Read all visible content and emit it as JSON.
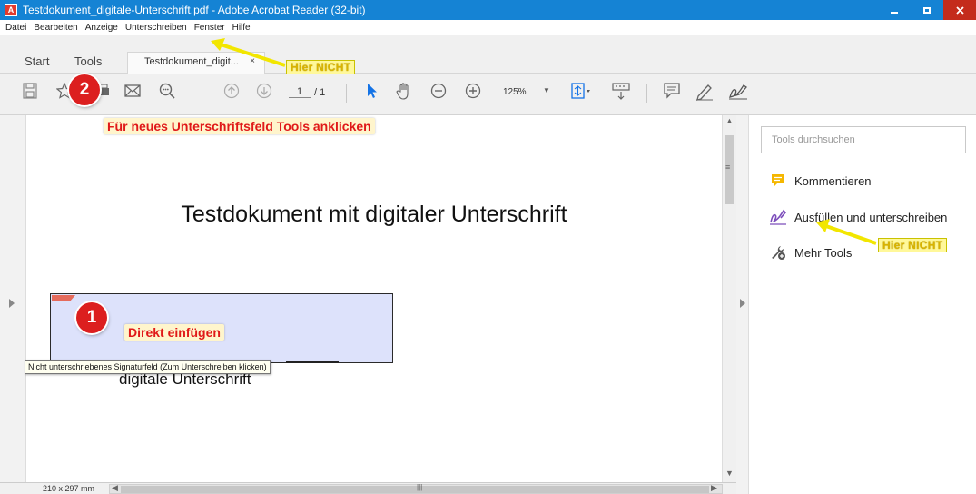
{
  "window": {
    "title": "Testdokument_digitale-Unterschrift.pdf - Adobe Acrobat Reader (32-bit)",
    "app_icon_glyph": "A"
  },
  "menu": [
    "Datei",
    "Bearbeiten",
    "Anzeige",
    "Unterschreiben",
    "Fenster",
    "Hilfe"
  ],
  "tabs": {
    "start": "Start",
    "tools": "Tools",
    "document": "Testdokument_digit...",
    "close_glyph": "×"
  },
  "toolbar": {
    "page_current": "1",
    "page_total": "/ 1",
    "zoom": "125%"
  },
  "document": {
    "heading": "Testdokument mit digitaler Unterschrift",
    "signature_caption": "digitale Unterschrift",
    "tooltip": "Nicht unterschriebenes Signaturfeld (Zum Unterschreiben klicken)",
    "page_size": "210 x 297 mm"
  },
  "tools_pane": {
    "search_placeholder": "Tools durchsuchen",
    "items": [
      {
        "label": "Kommentieren",
        "icon": "comment-icon",
        "color": "#f5b700"
      },
      {
        "label": "Ausfüllen und unterschreiben",
        "icon": "sign-pen-icon",
        "color": "#7c4dbb"
      },
      {
        "label": "Mehr Tools",
        "icon": "more-tools-icon",
        "color": "#555555"
      }
    ]
  },
  "annotations": {
    "badge_1": "1",
    "badge_2": "2",
    "direkt": "Direkt einfügen",
    "tools_hint": "Für neues Unterschriftsfeld Tools anklicken",
    "hier_nicht_menu": "Hier NICHT",
    "hier_nicht_tools": "Hier NICHT"
  },
  "colors": {
    "titlebar": "#1583d4",
    "close_button": "#c42b1c",
    "signature_field": "#dde2fb",
    "badge": "#dc1f1f",
    "annotation_red": "#e01919",
    "annotation_yellow": "#f2e600"
  }
}
